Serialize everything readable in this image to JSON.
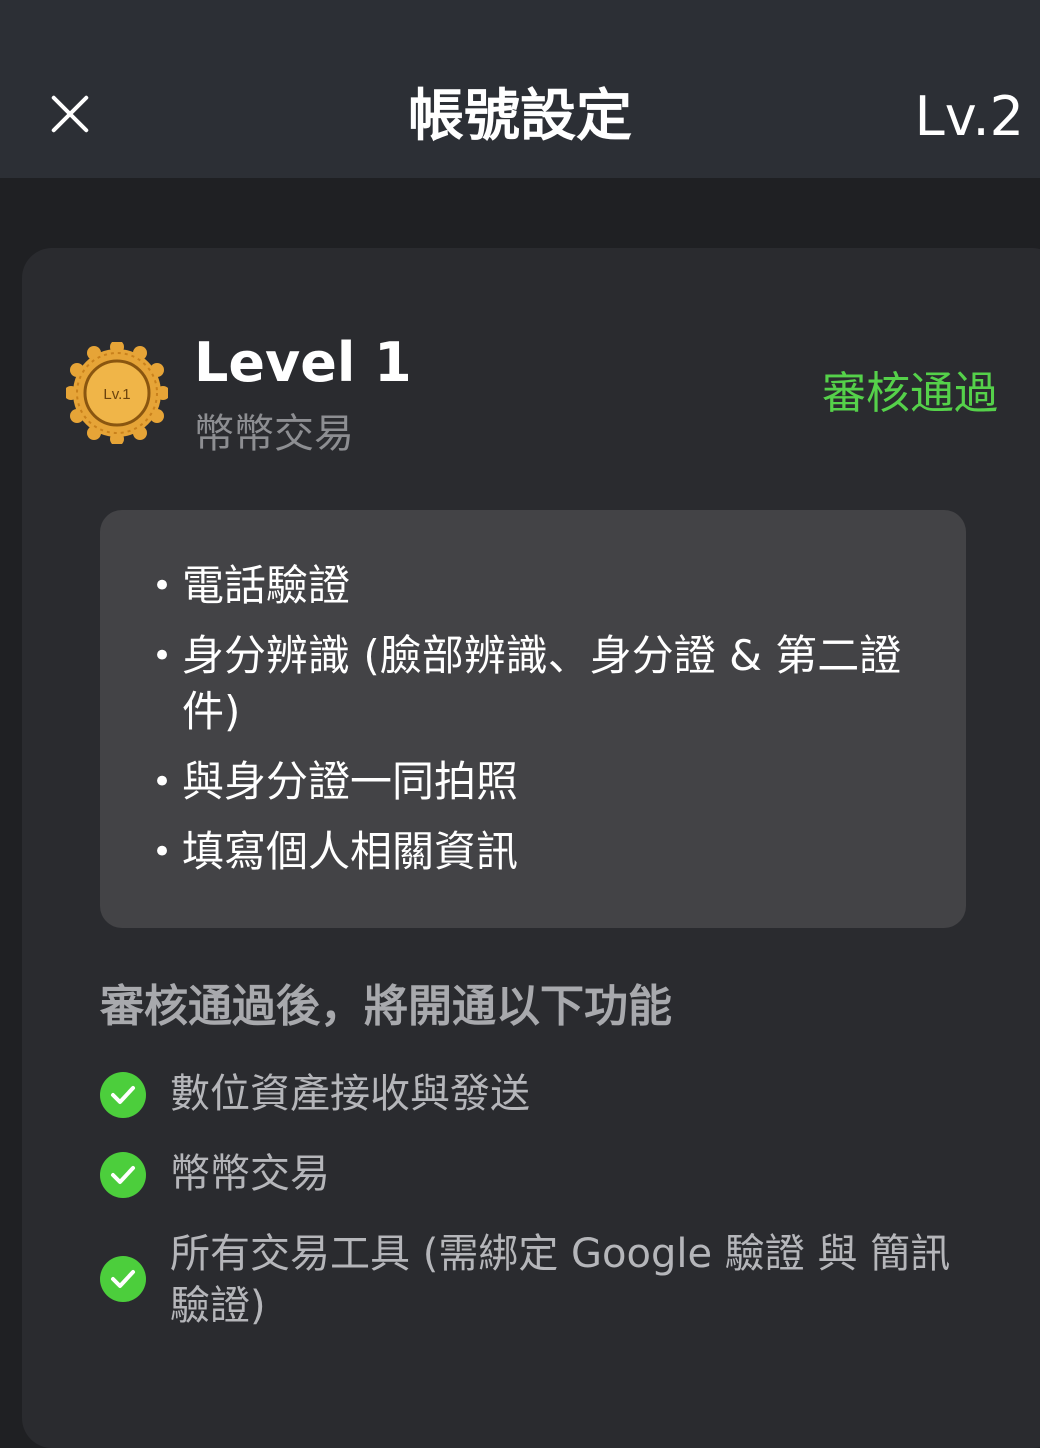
{
  "header": {
    "title": "帳號設定",
    "level": "Lv.2",
    "close_icon": "close-icon"
  },
  "level_card": {
    "badge_label": "Lv.1",
    "badge_icon": "level-badge-icon",
    "title": "Level 1",
    "subtitle": "幣幣交易",
    "status": "審核通過",
    "status_color": "#55d14a",
    "requirements": [
      "電話驗證",
      "身分辨識 (臉部辨識、身分證 & 第二證件)",
      "與身分證一同拍照",
      "填寫個人相關資訊"
    ],
    "features_heading": "審核通過後，將開通以下功能",
    "features": [
      "數位資產接收與發送",
      "幣幣交易",
      "所有交易工具 (需綁定 Google 驗證 與 簡訊驗證)"
    ],
    "feature_icon": "check-circle-icon",
    "accent_color": "#4cce3c",
    "badge_color": "#e6a437"
  }
}
